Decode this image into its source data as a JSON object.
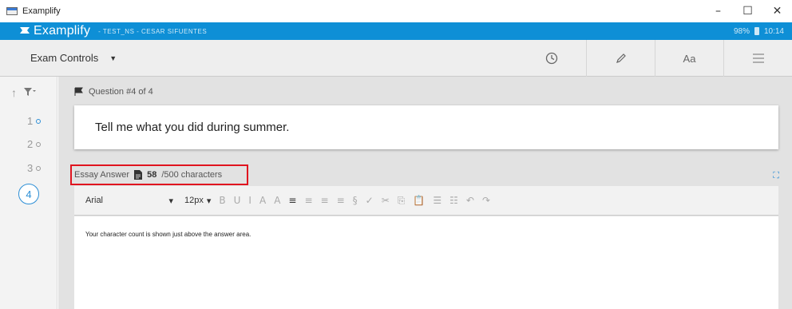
{
  "window": {
    "title": "Examplify",
    "minimize": "–",
    "maximize": "☐",
    "close": "✕"
  },
  "app_bar": {
    "logo": "Examplify",
    "exam_info": "- TEST_NS - CESAR SIFUENTES",
    "battery": "98%",
    "time": "10:14"
  },
  "toolbar": {
    "exam_controls": "Exam Controls",
    "font_tool": "Aa"
  },
  "sidebar": {
    "questions": [
      "1",
      "2",
      "3"
    ],
    "current": "4"
  },
  "question": {
    "header": "Question #4 of 4",
    "text": "Tell me what you did during summer."
  },
  "essay": {
    "label": "Essay Answer",
    "count": "58",
    "limit": "/500 characters"
  },
  "editor": {
    "font": "Arial",
    "size": "12px",
    "content": "Your character count is shown just above the answer area."
  },
  "colors": {
    "accent": "#0e8fd6",
    "highlight": "#e0141f"
  }
}
